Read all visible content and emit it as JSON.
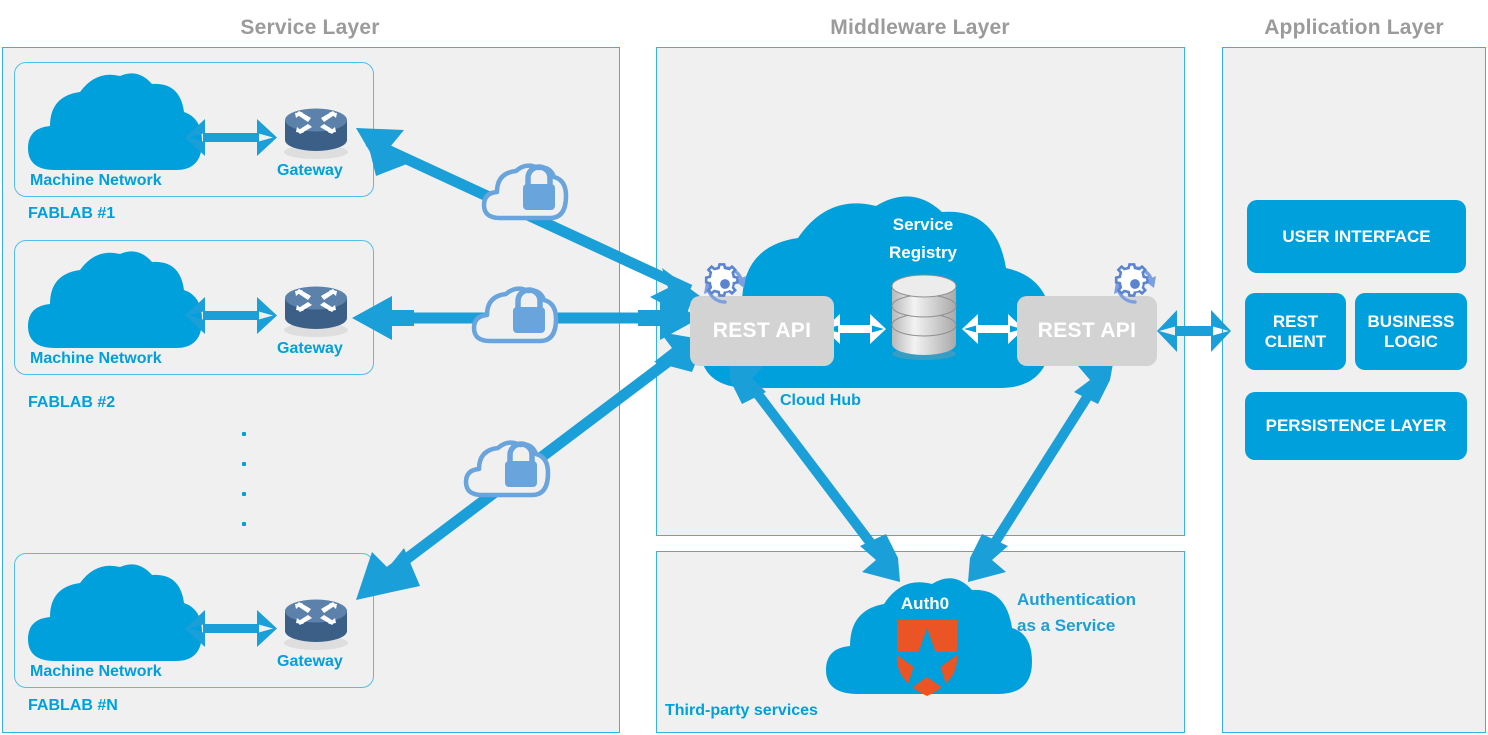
{
  "colors": {
    "primary_cyan": "#00a0dc",
    "panel_bg": "#f0f0f0",
    "panel_border": "#31b4e8",
    "title_gray": "#9b9b9b",
    "rest_api_gray": "#d3d3d3",
    "vpn_blue": "#6aa4dc",
    "router_dark": "#456a94",
    "auth0_orange": "#eb5424",
    "db_silver": "#d8d8d8"
  },
  "layers": {
    "service": {
      "title": "Service Layer"
    },
    "middleware": {
      "title": "Middleware Layer"
    },
    "application": {
      "title": "Application Layer"
    }
  },
  "service_layer": {
    "fablabs": [
      {
        "name": "FABLAB #1",
        "network_label": "Machine Network",
        "gateway_label": "Gateway"
      },
      {
        "name": "FABLAB #2",
        "network_label": "Machine Network",
        "gateway_label": "Gateway"
      },
      {
        "name": "FABLAB #N",
        "network_label": "Machine Network",
        "gateway_label": "Gateway"
      }
    ],
    "continuation_dots": 4
  },
  "middleware_layer": {
    "cloud_hub_label": "Cloud Hub",
    "service_registry_label_line1": "Service",
    "service_registry_label_line2": "Registry",
    "rest_api_left": "REST API",
    "rest_api_right": "REST API",
    "gear_icon_name": "gear-refresh-icon"
  },
  "third_party": {
    "panel_label": "Third-party services",
    "service_name": "Auth0",
    "caption_line1": "Authentication",
    "caption_line2": "as a Service"
  },
  "application_layer": {
    "boxes": [
      {
        "label": "USER INTERFACE"
      },
      {
        "label": "REST\nCLIENT"
      },
      {
        "label": "BUSINESS\nLOGIC"
      },
      {
        "label": "PERSISTENCE LAYER"
      }
    ],
    "box_labels": {
      "user_interface": "USER INTERFACE",
      "rest_client_l1": "REST",
      "rest_client_l2": "CLIENT",
      "business_logic_l1": "BUSINESS",
      "business_logic_l2": "LOGIC",
      "persistence_layer": "PERSISTENCE LAYER"
    }
  },
  "connections": {
    "vpn_tunnels": 3,
    "vpn_icon_name": "cloud-lock-vpn-icon"
  }
}
